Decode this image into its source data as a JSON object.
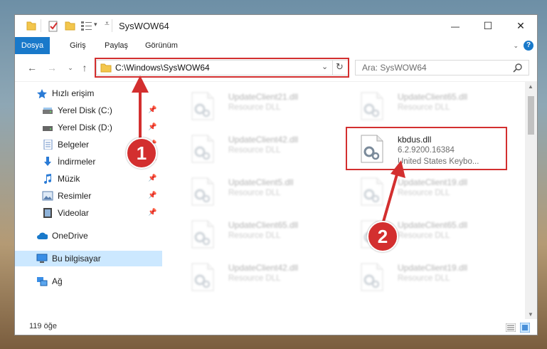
{
  "window": {
    "title": "SysWOW64",
    "controls": {
      "minimize": "—",
      "maximize": "☐",
      "close": "✕"
    }
  },
  "ribbon": {
    "tabs": [
      "Dosya",
      "Giriş",
      "Paylaş",
      "Görünüm"
    ],
    "help": "?"
  },
  "nav": {
    "address": "C:\\Windows\\SysWOW64",
    "search_placeholder": "Ara: SysWOW64"
  },
  "sidebar": {
    "items": [
      {
        "label": "Hızlı erişim",
        "icon": "star-icon",
        "pinned": false
      },
      {
        "label": "Yerel Disk (C:)",
        "icon": "drive-icon",
        "pinned": true
      },
      {
        "label": "Yerel Disk (D:)",
        "icon": "drive-icon",
        "pinned": true
      },
      {
        "label": "Belgeler",
        "icon": "document-icon",
        "pinned": true
      },
      {
        "label": "İndirmeler",
        "icon": "download-icon",
        "pinned": true
      },
      {
        "label": "Müzik",
        "icon": "music-icon",
        "pinned": true
      },
      {
        "label": "Resimler",
        "icon": "pictures-icon",
        "pinned": true
      },
      {
        "label": "Videolar",
        "icon": "video-icon",
        "pinned": true
      },
      {
        "label": "OneDrive",
        "icon": "cloud-icon",
        "pinned": false
      },
      {
        "label": "Bu bilgisayar",
        "icon": "computer-icon",
        "pinned": false
      },
      {
        "label": "Ağ",
        "icon": "network-icon",
        "pinned": false
      }
    ]
  },
  "files": {
    "left": [
      {
        "name": "UpdateClient21.dll",
        "desc": "Resource DLL"
      },
      {
        "name": "UpdateClient42.dll",
        "desc": "Resource DLL"
      },
      {
        "name": "UpdateClient5.dll",
        "desc": "Resource DLL"
      },
      {
        "name": "UpdateClient65.dll",
        "desc": "Resource DLL"
      },
      {
        "name": "UpdateClient42.dll",
        "desc": "Resource DLL"
      }
    ],
    "right": [
      {
        "name": "UpdateClient65.dll",
        "desc": "Resource DLL"
      },
      {
        "name": "kbdus.dll",
        "desc": "6.2.9200.16384",
        "desc2": "United States Keybo..."
      },
      {
        "name": "UpdateClient19.dll",
        "desc": "Resource DLL"
      },
      {
        "name": "UpdateClient65.dll",
        "desc": "Resource DLL"
      },
      {
        "name": "UpdateClient19.dll",
        "desc": "Resource DLL"
      }
    ]
  },
  "status": {
    "item_count": "119 öğe"
  },
  "annotations": {
    "badge1": "1",
    "badge2": "2",
    "color": "#d32f2f"
  }
}
